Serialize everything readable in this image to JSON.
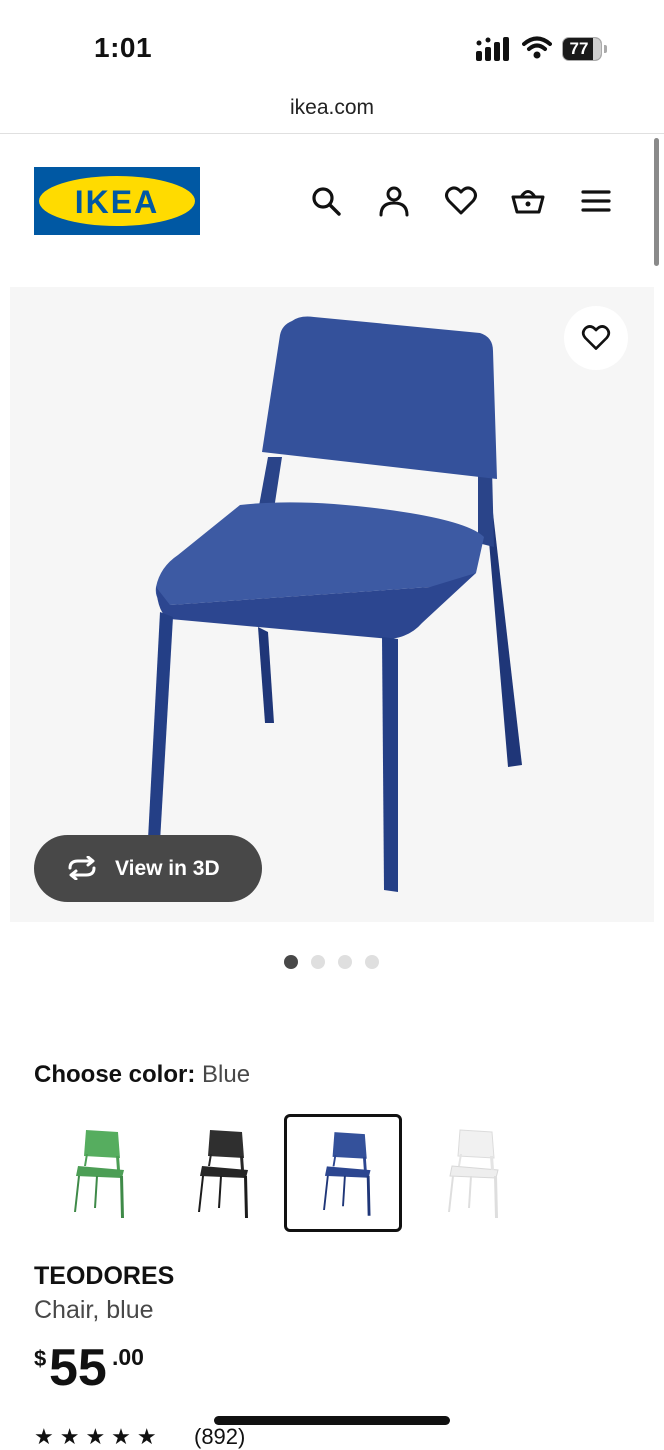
{
  "status_bar": {
    "time": "1:01",
    "battery": "77"
  },
  "browser": {
    "url": "ikea.com"
  },
  "header": {
    "logo_text": "IKEA",
    "icons": [
      "search-icon",
      "account-icon",
      "favorites-icon",
      "cart-icon",
      "menu-icon"
    ]
  },
  "gallery": {
    "view_3d_label": "View in 3D",
    "image_count": 4,
    "active_index": 0
  },
  "color": {
    "label": "Choose color:",
    "value": "Blue",
    "options": [
      {
        "name": "Green",
        "hex": "#4fa65a"
      },
      {
        "name": "Black",
        "hex": "#2b2b2b"
      },
      {
        "name": "Blue",
        "hex": "#27428a",
        "selected": true
      },
      {
        "name": "White",
        "hex": "#ececec"
      }
    ]
  },
  "product": {
    "name": "TEODORES",
    "description": "Chair, blue",
    "price_currency": "$",
    "price_integer": "55",
    "price_decimal": ".00",
    "rating_stars": "★★★★★",
    "review_count": "(892)"
  },
  "colors": {
    "ikea_blue": "#0058a3",
    "ikea_yellow": "#ffdb00",
    "chair_blue": "#2f4c94"
  }
}
